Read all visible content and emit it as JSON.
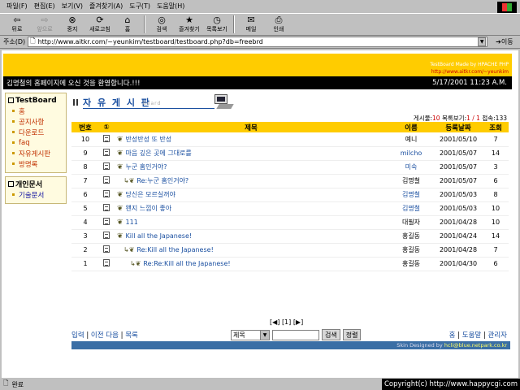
{
  "menu": [
    "파일(F)",
    "편집(E)",
    "보기(V)",
    "즐겨찾기(A)",
    "도구(T)",
    "도움말(H)"
  ],
  "toolbar": [
    {
      "label": "뒤로",
      "icon": "back-arrow-icon",
      "disabled": false
    },
    {
      "label": "앞으로",
      "icon": "forward-arrow-icon",
      "disabled": true
    },
    {
      "label": "중지",
      "icon": "stop-icon",
      "disabled": false
    },
    {
      "label": "새로고침",
      "icon": "refresh-icon",
      "disabled": false
    },
    {
      "label": "홈",
      "icon": "home-icon",
      "disabled": false
    },
    {
      "label": "검색",
      "icon": "search-icon",
      "disabled": false
    },
    {
      "label": "즐겨찾기",
      "icon": "favorites-icon",
      "disabled": false
    },
    {
      "label": "목록보기",
      "icon": "history-icon",
      "disabled": false
    },
    {
      "label": "메일",
      "icon": "mail-icon",
      "disabled": false
    },
    {
      "label": "인쇄",
      "icon": "print-icon",
      "disabled": false
    }
  ],
  "address": {
    "label": "주소(D)",
    "url": "http://www.aitkr.com/~yeunkim/testboard/testboard.php?db=freebrd",
    "go": "이동"
  },
  "header": {
    "credit": "TestBoard Made by HPACHE PHP",
    "credit_url": "http://www.aitkr.com/~yeunkim",
    "welcome": "김명철의 홈페이지에 오신 것을 환영합니다.!!!",
    "datetime": "5/17/2001  11:23 A.M."
  },
  "sidebar": {
    "box1_title": "TestBoard",
    "box1_items": [
      "홈",
      "공지사항",
      "다운로드",
      "faq",
      "자유게시판",
      "방명록"
    ],
    "box2_title": "개인문서",
    "box2_items": [
      "기술문서"
    ]
  },
  "board": {
    "title": "자 유 게 시 판",
    "subtitle": "board",
    "count_label": "게시물:",
    "count_value": "10",
    "page_label": "목록보기:",
    "page_value": "1 / 1",
    "visit_label": "접속:",
    "visit_value": "133",
    "columns": {
      "num": "번호",
      "icon": "①",
      "title": "제목",
      "name": "이름",
      "date": "등록날짜",
      "views": "조회"
    },
    "rows": [
      {
        "num": "10",
        "title": "반성반성 또 반성",
        "name": "예니",
        "date": "2001/05/10",
        "views": "7",
        "depth": 0,
        "link": false
      },
      {
        "num": "9",
        "title": "마음 깊은 곳에 그대로를",
        "name": "milcho",
        "date": "2001/05/07",
        "views": "14",
        "depth": 0,
        "link": true
      },
      {
        "num": "8",
        "title": "누군 홈인거야?",
        "name": "미숙",
        "date": "2001/05/07",
        "views": "3",
        "depth": 0,
        "link": true
      },
      {
        "num": "7",
        "title": "Re:누군 홈인거야?",
        "name": "김명철",
        "date": "2001/05/07",
        "views": "6",
        "depth": 1,
        "link": false
      },
      {
        "num": "6",
        "title": "당신은 모르실꺼야",
        "name": "김명철",
        "date": "2001/05/03",
        "views": "8",
        "depth": 0,
        "link": true
      },
      {
        "num": "5",
        "title": "왠지 느낌이 좋아",
        "name": "김명철",
        "date": "2001/05/03",
        "views": "10",
        "depth": 0,
        "link": true
      },
      {
        "num": "4",
        "title": "111",
        "name": "대필자",
        "date": "2001/04/28",
        "views": "10",
        "depth": 0,
        "link": false
      },
      {
        "num": "3",
        "title": "Kill all the Japanese!",
        "name": "홍길동",
        "date": "2001/04/24",
        "views": "14",
        "depth": 0,
        "link": false
      },
      {
        "num": "2",
        "title": "Re:Kill all the Japanese!",
        "name": "홍길동",
        "date": "2001/04/28",
        "views": "7",
        "depth": 1,
        "link": false
      },
      {
        "num": "1",
        "title": "Re:Re:Kill all the Japanese!",
        "name": "홍길동",
        "date": "2001/04/30",
        "views": "6",
        "depth": 2,
        "link": false
      }
    ],
    "pager": "[◀] [1] [▶]"
  },
  "bottom": {
    "left_links": [
      "입력",
      "이전 다음",
      "목록"
    ],
    "search_select": "제목",
    "search_button": "검색",
    "sort_button": "정렬",
    "right_links": [
      "홈",
      "도움말",
      "관리자"
    ]
  },
  "skin": {
    "label": "Skin Designed by",
    "email": "hcli@blue.netpark.co.kr"
  },
  "status": {
    "text": "완료",
    "copyright": "Copyright(c) http://www.happycgi.com"
  }
}
